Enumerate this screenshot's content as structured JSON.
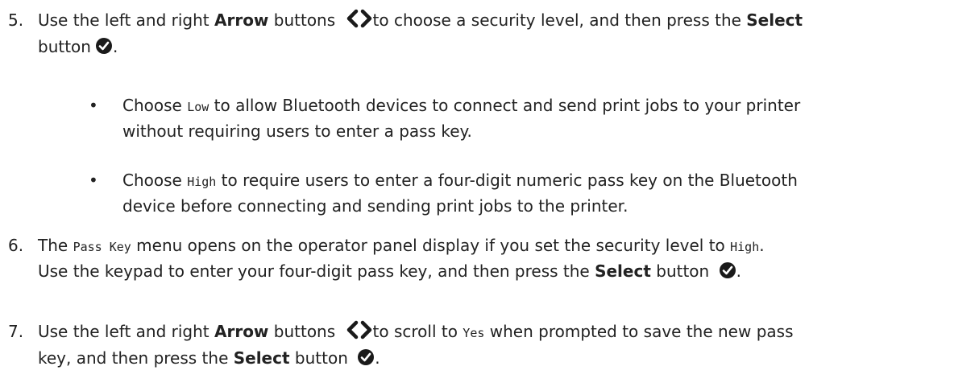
{
  "steps": [
    {
      "number": "5.",
      "t1": "Use the left and right ",
      "arrow": "Arrow",
      "t2": " buttons ",
      "t3": "to choose a security level, and then press the ",
      "select": "Select",
      "t4": "button",
      "t5": "."
    },
    {
      "number": "6.",
      "t1": "The ",
      "code1": "Pass Key",
      "t2": " menu opens on the operator panel display if you set the security level to ",
      "code2": "High",
      "t3": ".",
      "t4": "Use the keypad to enter your four-digit pass key, and then press the ",
      "select": "Select",
      "t5": " button ",
      "t6": "."
    },
    {
      "number": "7.",
      "t1": "Use the left and right ",
      "arrow": "Arrow",
      "t2": " buttons ",
      "t3": "to scroll to ",
      "code": "Yes",
      "t4": " when prompted to save the new pass",
      "t5": "key, and then press the ",
      "select": "Select",
      "t6": " button ",
      "t7": "."
    }
  ],
  "bullets": [
    {
      "marker": "•",
      "t1": "Choose ",
      "code": "Low",
      "t2": " to allow Bluetooth devices to connect and send print jobs to your printer",
      "t3": "without requiring users to enter a pass key."
    },
    {
      "marker": "•",
      "t1": "Choose ",
      "code": "High",
      "t2": " to require users to enter a four-digit numeric pass key on the Bluetooth",
      "t3": "device before connecting and sending print jobs to the printer."
    }
  ],
  "icons": {
    "arrows": "left-right-arrow-buttons-icon",
    "select": "select-check-button-icon"
  },
  "colors": {
    "text": "#222222",
    "icon": "#1a1a1a"
  }
}
